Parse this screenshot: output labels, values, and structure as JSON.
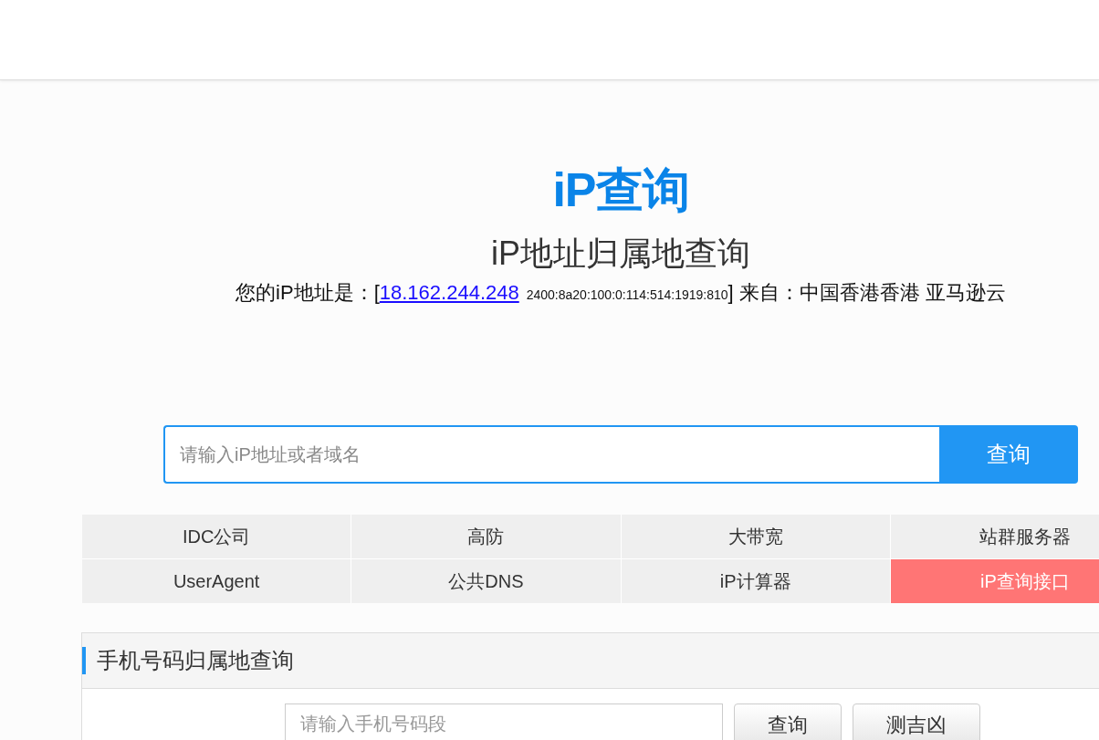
{
  "logo": {
    "text": "iP查询"
  },
  "title": "iP地址归属地查询",
  "ip_line": {
    "label": "您的iP地址是：[",
    "ipv4": "18.162.244.248",
    "ipv6": "2400:8a20:100:0:114:514:1919:810",
    "suffix": "] 来自：中国香港香港 亚马逊云"
  },
  "search": {
    "placeholder": "请输入iP地址或者域名",
    "button": "查询"
  },
  "nav": [
    {
      "label": "IDC公司",
      "selected": false
    },
    {
      "label": "高防",
      "selected": false
    },
    {
      "label": "大带宽",
      "selected": false
    },
    {
      "label": "站群服务器",
      "selected": false
    },
    {
      "label": "UserAgent",
      "selected": false
    },
    {
      "label": "公共DNS",
      "selected": false
    },
    {
      "label": "iP计算器",
      "selected": false
    },
    {
      "label": "iP查询接口",
      "selected": true
    }
  ],
  "phone_panel": {
    "title": "手机号码归属地查询",
    "placeholder": "请输入手机号码段",
    "buttons": [
      "查询",
      "测吉凶"
    ]
  }
}
